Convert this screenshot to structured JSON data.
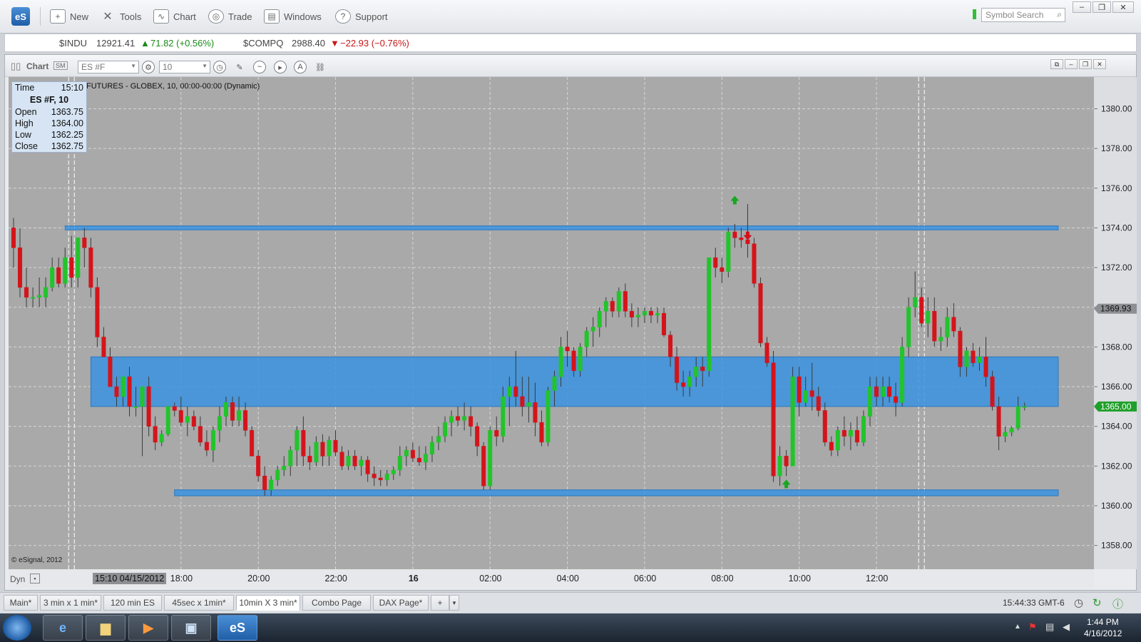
{
  "app": {
    "logo": "eS"
  },
  "toolbar": {
    "items": [
      {
        "label": "New",
        "icon": "new-chart-icon"
      },
      {
        "label": "Tools",
        "icon": "tools-icon"
      },
      {
        "label": "Chart",
        "icon": "chart-icon"
      },
      {
        "label": "Trade",
        "icon": "trade-icon"
      },
      {
        "label": "Windows",
        "icon": "windows-icon"
      },
      {
        "label": "Support",
        "icon": "support-icon"
      }
    ],
    "search_placeholder": "Symbol Search"
  },
  "ticker": {
    "indu": {
      "symbol": "$INDU",
      "price": "12921.41",
      "change": "71.82 (+0.56%)",
      "direction": "up"
    },
    "compq": {
      "symbol": "$COMPQ",
      "price": "2988.40",
      "change": "−22.93 (−0.76%)",
      "direction": "down"
    }
  },
  "chart_window": {
    "title": "Chart",
    "symbol_value": "ES #F",
    "interval_value": "10",
    "description": "FUTURES - GLOBEX, 10, 00:00-00:00 (Dynamic)",
    "copyright": "© eSignal, 2012",
    "dyn_label": "Dyn",
    "cursor_time": "15:10 04/15/2012"
  },
  "infobox": {
    "time_label": "Time",
    "time_value": "15:10",
    "symbol": "ES #F, 10",
    "rows": [
      {
        "label": "Open",
        "value": "1363.75"
      },
      {
        "label": "High",
        "value": "1364.00"
      },
      {
        "label": "Low",
        "value": "1362.25"
      },
      {
        "label": "Close",
        "value": "1362.75"
      }
    ]
  },
  "chart_data": {
    "type": "candlestick",
    "ylim": [
      1356.8,
      1381.6
    ],
    "y_ticks": [
      "1380.00",
      "1378.00",
      "1376.00",
      "1374.00",
      "1372.00",
      "1370.00",
      "1368.00",
      "1366.00",
      "1364.00",
      "1362.00",
      "1360.00",
      "1358.00"
    ],
    "x_ticks": [
      "18:00",
      "20:00",
      "22:00",
      "16",
      "02:00",
      "04:00",
      "06:00",
      "08:00",
      "10:00",
      "12:00"
    ],
    "price_markers": [
      {
        "label": "1369.93",
        "value": 1369.93,
        "color": "#8c8f93"
      },
      {
        "label": "1365.00",
        "value": 1365.0,
        "color": "#1fa02a"
      }
    ],
    "zones": [
      {
        "y_low": 1373.9,
        "y_high": 1374.1,
        "x_start_time": "15:00"
      },
      {
        "y_low": 1365.0,
        "y_high": 1367.5,
        "x_start_time": "15:40"
      },
      {
        "y_low": 1360.5,
        "y_high": 1360.8,
        "x_start_time": "17:50"
      }
    ],
    "up_color": "#22c42b",
    "down_color": "#d4141b",
    "candles": [
      [
        1374.0,
        1374.5,
        1372.0,
        1373.0
      ],
      [
        1373.0,
        1374.0,
        1370.5,
        1371.0
      ],
      [
        1371.0,
        1372.0,
        1370.0,
        1370.5
      ],
      [
        1370.5,
        1371.0,
        1370.0,
        1370.5
      ],
      [
        1370.5,
        1371.5,
        1370.0,
        1370.6
      ],
      [
        1370.5,
        1371.5,
        1370.0,
        1371.0
      ],
      [
        1371.0,
        1372.5,
        1370.8,
        1372.0
      ],
      [
        1372.0,
        1372.5,
        1371.0,
        1371.2
      ],
      [
        1371.2,
        1373.0,
        1371.0,
        1372.5
      ],
      [
        1372.5,
        1373.6,
        1371.0,
        1371.5
      ],
      [
        1371.5,
        1373.5,
        1371.0,
        1373.5
      ],
      [
        1373.5,
        1374.0,
        1372.0,
        1373.0
      ],
      [
        1373.0,
        1373.5,
        1370.5,
        1371.0
      ],
      [
        1371.0,
        1371.5,
        1368.0,
        1368.5
      ],
      [
        1368.5,
        1369.0,
        1367.5,
        1367.5
      ],
      [
        1367.5,
        1368.0,
        1366.0,
        1366.0
      ],
      [
        1366.0,
        1366.5,
        1365.0,
        1365.5
      ],
      [
        1365.5,
        1366.5,
        1365.0,
        1366.5
      ],
      [
        1366.5,
        1367.0,
        1364.5,
        1365.0
      ],
      [
        1365.0,
        1366.0,
        1364.5,
        1365.0
      ],
      [
        1365.0,
        1366.0,
        1362.5,
        1366.0
      ],
      [
        1366.0,
        1366.5,
        1363.5,
        1364.0
      ],
      [
        1364.0,
        1364.5,
        1362.8,
        1363.2
      ],
      [
        1363.2,
        1363.8,
        1363.0,
        1363.6
      ],
      [
        1363.6,
        1365.0,
        1363.5,
        1365.0
      ],
      [
        1365.0,
        1365.2,
        1364.5,
        1364.8
      ],
      [
        1364.8,
        1365.5,
        1364.0,
        1364.2
      ],
      [
        1364.2,
        1365.0,
        1363.5,
        1364.5
      ],
      [
        1364.5,
        1364.8,
        1363.8,
        1364.0
      ],
      [
        1364.0,
        1364.5,
        1363.0,
        1363.2
      ],
      [
        1363.2,
        1363.8,
        1362.5,
        1362.8
      ],
      [
        1362.8,
        1364.0,
        1362.2,
        1363.8
      ],
      [
        1363.8,
        1365.0,
        1363.2,
        1364.5
      ],
      [
        1364.5,
        1365.5,
        1364.0,
        1365.2
      ],
      [
        1365.2,
        1365.5,
        1364.0,
        1364.3
      ],
      [
        1364.3,
        1365.5,
        1364.0,
        1364.8
      ],
      [
        1364.8,
        1365.2,
        1363.5,
        1363.8
      ],
      [
        1363.8,
        1364.0,
        1362.5,
        1362.5
      ],
      [
        1362.5,
        1362.8,
        1361.2,
        1361.5
      ],
      [
        1361.5,
        1362.0,
        1360.5,
        1360.8
      ],
      [
        1360.8,
        1361.5,
        1360.5,
        1361.3
      ],
      [
        1361.3,
        1362.0,
        1361.0,
        1361.8
      ],
      [
        1361.8,
        1362.5,
        1361.5,
        1362.0
      ],
      [
        1362.0,
        1363.0,
        1361.5,
        1362.8
      ],
      [
        1362.8,
        1364.0,
        1362.0,
        1363.8
      ],
      [
        1363.8,
        1364.5,
        1362.0,
        1362.5
      ],
      [
        1362.5,
        1363.0,
        1361.8,
        1362.2
      ],
      [
        1362.2,
        1363.5,
        1362.0,
        1363.2
      ],
      [
        1363.2,
        1363.6,
        1362.0,
        1362.5
      ],
      [
        1362.5,
        1363.5,
        1362.0,
        1363.3
      ],
      [
        1363.3,
        1363.8,
        1362.5,
        1362.7
      ],
      [
        1362.7,
        1363.0,
        1361.8,
        1362.0
      ],
      [
        1362.0,
        1362.8,
        1361.8,
        1362.5
      ],
      [
        1362.5,
        1362.8,
        1361.8,
        1362.0
      ],
      [
        1362.0,
        1362.5,
        1361.5,
        1362.3
      ],
      [
        1362.3,
        1362.5,
        1361.2,
        1361.6
      ],
      [
        1361.6,
        1362.0,
        1361.0,
        1361.4
      ],
      [
        1361.4,
        1361.8,
        1361.0,
        1361.3
      ],
      [
        1361.3,
        1361.8,
        1361.0,
        1361.6
      ],
      [
        1361.6,
        1362.0,
        1361.3,
        1361.8
      ],
      [
        1361.8,
        1363.0,
        1361.5,
        1362.5
      ],
      [
        1362.5,
        1363.0,
        1362.0,
        1362.8
      ],
      [
        1362.8,
        1363.2,
        1362.2,
        1362.4
      ],
      [
        1362.4,
        1363.0,
        1362.0,
        1362.2
      ],
      [
        1362.2,
        1363.0,
        1361.8,
        1362.6
      ],
      [
        1362.6,
        1363.5,
        1362.2,
        1363.2
      ],
      [
        1363.2,
        1364.0,
        1362.8,
        1363.5
      ],
      [
        1363.5,
        1364.5,
        1363.2,
        1364.2
      ],
      [
        1364.2,
        1364.8,
        1363.5,
        1364.5
      ],
      [
        1364.5,
        1365.0,
        1364.0,
        1364.3
      ],
      [
        1364.3,
        1365.2,
        1363.8,
        1364.5
      ],
      [
        1364.5,
        1365.0,
        1363.5,
        1364.0
      ],
      [
        1364.0,
        1364.2,
        1362.5,
        1363.0
      ],
      [
        1363.0,
        1363.2,
        1360.8,
        1361.0
      ],
      [
        1361.0,
        1364.0,
        1360.8,
        1363.8
      ],
      [
        1363.8,
        1364.5,
        1363.0,
        1363.5
      ],
      [
        1363.5,
        1366.0,
        1363.2,
        1365.5
      ],
      [
        1365.5,
        1366.5,
        1364.0,
        1366.0
      ],
      [
        1366.0,
        1367.8,
        1365.0,
        1365.5
      ],
      [
        1365.5,
        1366.5,
        1364.5,
        1365.0
      ],
      [
        1365.0,
        1366.5,
        1364.2,
        1365.2
      ],
      [
        1365.2,
        1366.2,
        1363.5,
        1364.2
      ],
      [
        1364.2,
        1364.8,
        1363.0,
        1363.2
      ],
      [
        1363.2,
        1366.0,
        1363.0,
        1365.8
      ],
      [
        1365.8,
        1366.8,
        1365.0,
        1366.5
      ],
      [
        1366.5,
        1368.5,
        1366.0,
        1368.0
      ],
      [
        1368.0,
        1368.8,
        1367.0,
        1367.8
      ],
      [
        1367.8,
        1368.0,
        1366.5,
        1366.8
      ],
      [
        1366.8,
        1368.2,
        1366.5,
        1368.0
      ],
      [
        1368.0,
        1369.0,
        1367.5,
        1368.8
      ],
      [
        1368.8,
        1369.5,
        1368.0,
        1369.0
      ],
      [
        1369.0,
        1370.0,
        1368.5,
        1369.8
      ],
      [
        1369.8,
        1370.5,
        1369.0,
        1370.3
      ],
      [
        1370.3,
        1370.5,
        1369.5,
        1369.8
      ],
      [
        1369.8,
        1371.0,
        1369.5,
        1370.8
      ],
      [
        1370.8,
        1371.2,
        1369.5,
        1369.8
      ],
      [
        1369.8,
        1370.2,
        1369.0,
        1369.5
      ],
      [
        1369.5,
        1370.0,
        1369.0,
        1369.6
      ],
      [
        1369.6,
        1370.0,
        1369.2,
        1369.8
      ],
      [
        1369.8,
        1370.0,
        1369.2,
        1369.6
      ],
      [
        1369.6,
        1370.0,
        1369.2,
        1369.7
      ],
      [
        1369.7,
        1370.0,
        1368.5,
        1368.6
      ],
      [
        1368.6,
        1368.8,
        1367.0,
        1367.5
      ],
      [
        1367.5,
        1368.0,
        1365.8,
        1366.2
      ],
      [
        1366.2,
        1366.8,
        1365.5,
        1366.0
      ],
      [
        1366.0,
        1366.8,
        1365.5,
        1366.5
      ],
      [
        1366.5,
        1367.5,
        1366.0,
        1367.0
      ],
      [
        1367.0,
        1367.5,
        1366.0,
        1366.8
      ],
      [
        1366.8,
        1372.5,
        1366.5,
        1372.5
      ],
      [
        1372.5,
        1373.0,
        1371.5,
        1372.0
      ],
      [
        1372.0,
        1372.5,
        1371.2,
        1371.8
      ],
      [
        1371.8,
        1374.0,
        1371.5,
        1373.8
      ],
      [
        1373.8,
        1374.2,
        1373.0,
        1373.5
      ],
      [
        1373.5,
        1374.0,
        1373.0,
        1373.4
      ],
      [
        1373.4,
        1375.2,
        1372.5,
        1373.2
      ],
      [
        1373.2,
        1373.5,
        1371.0,
        1371.2
      ],
      [
        1371.2,
        1371.5,
        1368.0,
        1368.2
      ],
      [
        1368.2,
        1368.5,
        1367.0,
        1367.2
      ],
      [
        1367.2,
        1367.8,
        1361.2,
        1361.5
      ],
      [
        1361.5,
        1363.0,
        1361.0,
        1362.5
      ],
      [
        1362.5,
        1362.8,
        1361.5,
        1362.0
      ],
      [
        1362.0,
        1367.0,
        1362.0,
        1366.5
      ],
      [
        1366.5,
        1367.0,
        1364.5,
        1365.2
      ],
      [
        1365.2,
        1366.5,
        1365.0,
        1365.8
      ],
      [
        1365.8,
        1367.2,
        1364.8,
        1365.5
      ],
      [
        1365.5,
        1366.0,
        1364.5,
        1364.8
      ],
      [
        1364.8,
        1365.2,
        1363.0,
        1363.2
      ],
      [
        1363.2,
        1363.5,
        1362.5,
        1362.8
      ],
      [
        1362.8,
        1364.0,
        1362.5,
        1363.8
      ],
      [
        1363.8,
        1364.5,
        1363.0,
        1363.5
      ],
      [
        1363.5,
        1364.2,
        1362.8,
        1363.8
      ],
      [
        1363.8,
        1364.5,
        1363.0,
        1363.2
      ],
      [
        1363.2,
        1364.8,
        1363.0,
        1364.5
      ],
      [
        1364.5,
        1366.5,
        1364.0,
        1366.0
      ],
      [
        1366.0,
        1366.5,
        1365.0,
        1365.5
      ],
      [
        1365.5,
        1366.5,
        1365.0,
        1366.0
      ],
      [
        1366.0,
        1366.5,
        1365.2,
        1365.5
      ],
      [
        1365.5,
        1366.2,
        1364.5,
        1365.2
      ],
      [
        1365.2,
        1368.5,
        1365.0,
        1368.0
      ],
      [
        1368.0,
        1370.5,
        1367.5,
        1370.0
      ],
      [
        1370.0,
        1371.8,
        1369.5,
        1370.5
      ],
      [
        1370.5,
        1371.0,
        1369.0,
        1369.2
      ],
      [
        1369.2,
        1370.5,
        1368.5,
        1369.8
      ],
      [
        1369.8,
        1370.5,
        1368.0,
        1368.3
      ],
      [
        1368.3,
        1369.0,
        1367.8,
        1368.5
      ],
      [
        1368.5,
        1370.0,
        1368.0,
        1369.5
      ],
      [
        1369.5,
        1370.2,
        1368.5,
        1368.8
      ],
      [
        1368.8,
        1369.0,
        1366.5,
        1367.0
      ],
      [
        1367.0,
        1368.0,
        1366.5,
        1367.8
      ],
      [
        1367.8,
        1368.2,
        1367.0,
        1367.2
      ],
      [
        1367.2,
        1368.0,
        1366.8,
        1367.5
      ],
      [
        1367.5,
        1368.5,
        1366.0,
        1366.5
      ],
      [
        1366.5,
        1366.8,
        1364.8,
        1365.0
      ],
      [
        1365.0,
        1365.5,
        1362.8,
        1363.5
      ],
      [
        1363.5,
        1364.0,
        1363.2,
        1363.7
      ],
      [
        1363.7,
        1364.0,
        1363.5,
        1363.9
      ],
      [
        1363.9,
        1365.5,
        1363.8,
        1365.0
      ],
      [
        1365.0,
        1365.2,
        1364.8,
        1365.0
      ]
    ],
    "markers": [
      {
        "type": "up",
        "candle": 112,
        "value": 1375.4
      },
      {
        "type": "down",
        "candle": 114,
        "value": 1373.6
      },
      {
        "type": "up",
        "candle": 120,
        "value": 1361.1
      }
    ]
  },
  "tabs": [
    {
      "label": "Main*",
      "active": false
    },
    {
      "label": "3 min x 1 min*",
      "active": false
    },
    {
      "label": "120 min ES",
      "active": false
    },
    {
      "label": "45sec x 1min*",
      "active": false
    },
    {
      "label": "10min X 3 min*",
      "active": true
    },
    {
      "label": "Combo Page",
      "active": false
    },
    {
      "label": "DAX Page*",
      "active": false
    }
  ],
  "status": {
    "clock": "15:44:33 GMT-6"
  },
  "taskbar": {
    "time": "1:44 PM",
    "date": "4/16/2012"
  }
}
